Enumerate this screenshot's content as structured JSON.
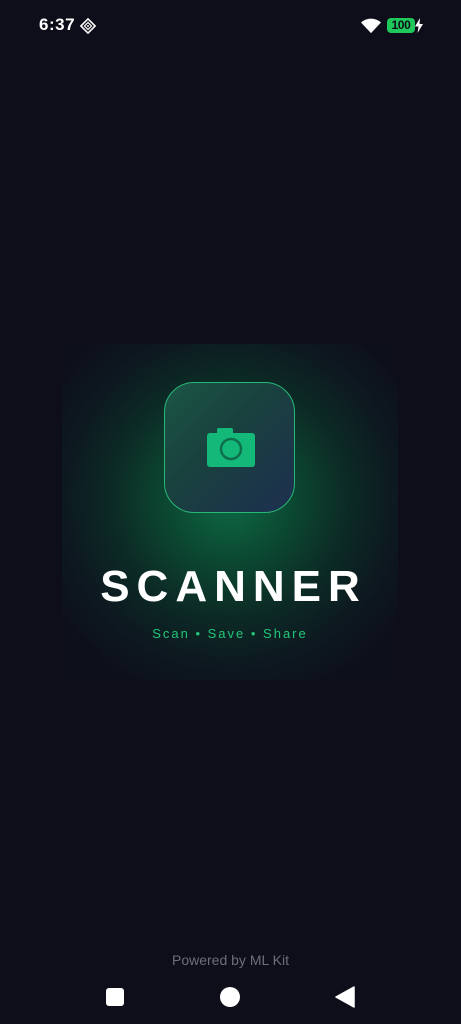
{
  "status_bar": {
    "time": "6:37",
    "battery_level": "100",
    "icons": [
      "notification-icon",
      "wifi-icon",
      "battery-icon",
      "charging-bolt-icon"
    ]
  },
  "splash": {
    "logo_icon": "camera-icon",
    "title": "SCANNER",
    "tagline": "Scan • Save • Share"
  },
  "footer": {
    "powered_by": "Powered by ML Kit"
  },
  "nav_bar": {
    "buttons": [
      "recents-button",
      "home-button",
      "back-button"
    ]
  },
  "colors": {
    "background": "#0d0e19",
    "accent": "#22c77a",
    "battery": "#1ec85a"
  }
}
